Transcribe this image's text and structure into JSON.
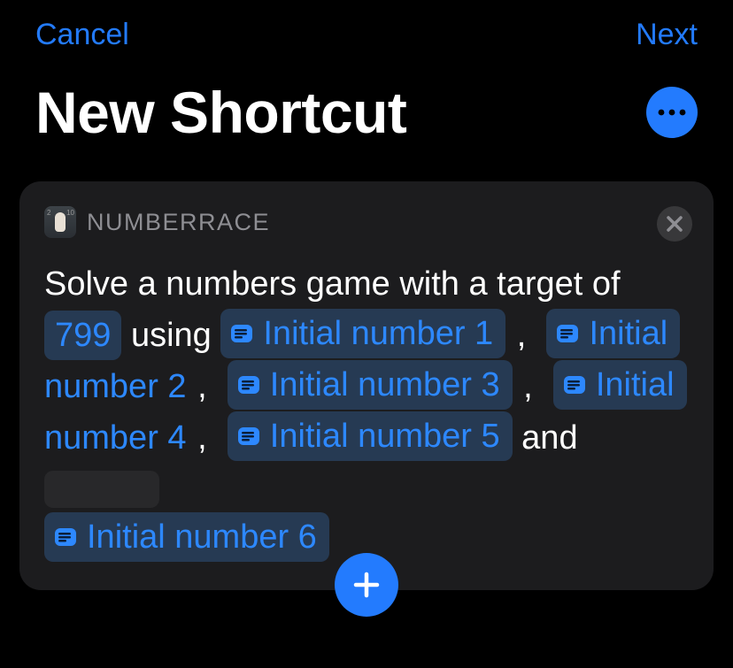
{
  "nav": {
    "cancel": "Cancel",
    "next": "Next"
  },
  "header": {
    "title": "New Shortcut"
  },
  "action": {
    "app_name": "NUMBERRACE",
    "text": {
      "t1": "Solve a numbers game with a target of ",
      "target": "799",
      "t2": " using ",
      "p1": "Initial number 1",
      "p2a": "Initial",
      "p2b": "number 2",
      "p3": "Initial number 3",
      "p4a": "Initial",
      "p4b": "number 4",
      "p5": "Initial number 5",
      "and": " and ",
      "p6": "Initial number 6",
      "comma": ","
    }
  },
  "colors": {
    "accent": "#237BFE",
    "link": "#2D88FF",
    "card": "#1C1C1E",
    "muted": "#8E8E93"
  }
}
